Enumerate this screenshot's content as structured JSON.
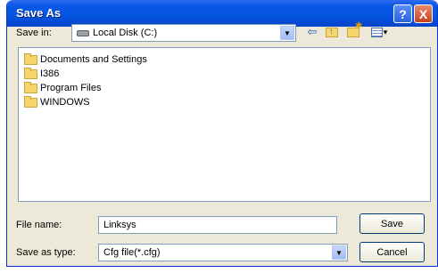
{
  "window": {
    "title": "Save As",
    "help_label": "?",
    "close_label": "X"
  },
  "save_in": {
    "label": "Save in:",
    "value": "Local Disk (C:)"
  },
  "toolbar": {
    "icons": [
      "back-icon",
      "up-folder-icon",
      "new-folder-icon",
      "view-menu-icon"
    ]
  },
  "files": [
    {
      "name": "Documents and Settings"
    },
    {
      "name": "I386"
    },
    {
      "name": "Program Files"
    },
    {
      "name": "WINDOWS"
    }
  ],
  "file_name": {
    "label": "File name:",
    "value": "Linksys"
  },
  "save_as_type": {
    "label": "Save as type:",
    "value": "Cfg file(*.cfg)"
  },
  "buttons": {
    "save": "Save",
    "cancel": "Cancel"
  }
}
